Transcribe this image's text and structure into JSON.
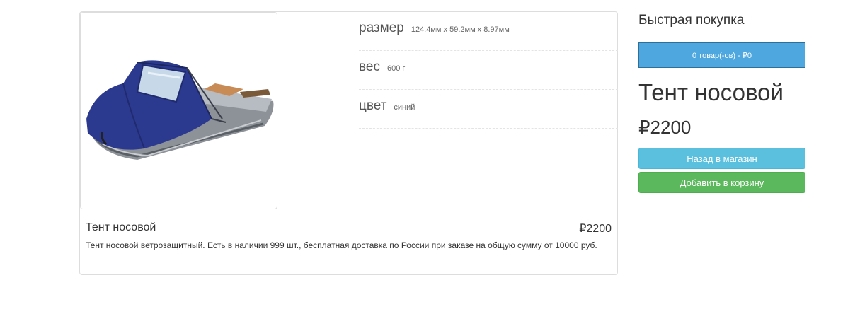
{
  "product": {
    "image_alt": "Тент носовой на лодке",
    "specs": [
      {
        "label": "размер",
        "value": "124.4мм x 59.2мм x 8.97мм"
      },
      {
        "label": "вес",
        "value": "600 г"
      },
      {
        "label": "цвет",
        "value": "синий"
      }
    ],
    "caption_title": "Тент носовой",
    "caption_price": "₽2200",
    "description": "Тент носовой ветрозащитный. Есть в наличии 999 шт., бесплатная доставка по России при заказе на общую сумму от 10000 руб."
  },
  "sidebar": {
    "quick_buy_title": "Быстрая покупка",
    "cart_label": "0 товар(-ов) - ₽0",
    "product_name": "Тент носовой",
    "product_price": "₽2200",
    "back_button": "Назад в магазин",
    "add_button": "Добавить в корзину"
  },
  "colors": {
    "cart_button": "#4ea8df",
    "back_button": "#5bc0de",
    "add_button": "#5cb85c",
    "tent": "#2b3a8f",
    "boat_hull": "#8d9299"
  }
}
